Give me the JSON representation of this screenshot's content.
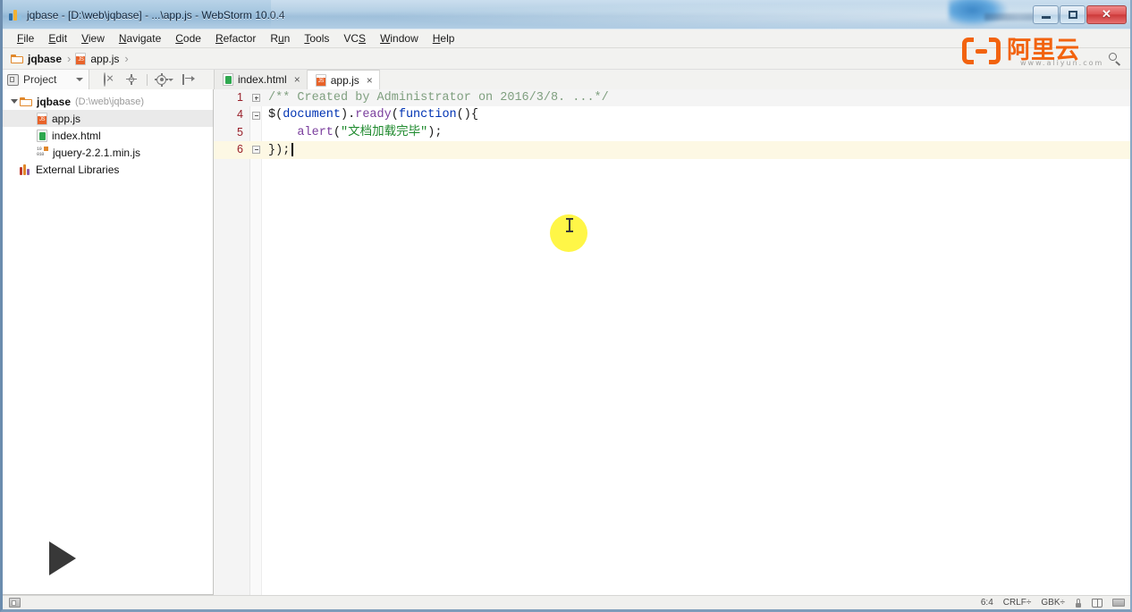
{
  "window": {
    "title": "jqbase - [D:\\web\\jqbase] - ...\\app.js - WebStorm 10.0.4",
    "icon": "webstorm-icon",
    "controls": {
      "minimize": "minimize-button",
      "maximize": "maximize-button",
      "close_label": "✕"
    }
  },
  "menu": {
    "items": [
      {
        "label": "File",
        "mnemonic": "F"
      },
      {
        "label": "Edit",
        "mnemonic": "E"
      },
      {
        "label": "View",
        "mnemonic": "V"
      },
      {
        "label": "Navigate",
        "mnemonic": "N"
      },
      {
        "label": "Code",
        "mnemonic": "C"
      },
      {
        "label": "Refactor",
        "mnemonic": "R"
      },
      {
        "label": "Run",
        "mnemonic": "u"
      },
      {
        "label": "Tools",
        "mnemonic": "T"
      },
      {
        "label": "VCS",
        "mnemonic": "S"
      },
      {
        "label": "Window",
        "mnemonic": "W"
      },
      {
        "label": "Help",
        "mnemonic": "H"
      }
    ]
  },
  "breadcrumb": {
    "separator": "›",
    "items": [
      {
        "label": "jqbase",
        "icon": "folder-icon",
        "bold": true
      },
      {
        "label": "app.js",
        "icon": "js-file-icon",
        "bold": false
      }
    ],
    "search_icon": "search-icon"
  },
  "tool_window": {
    "tab_label": "Project",
    "tab_icon": "project-icon",
    "dropdown_icon": "chevron-down-icon",
    "tools": [
      {
        "name": "collapse-all-icon",
        "title": "Collapse All"
      },
      {
        "name": "scroll-from-source-icon",
        "title": "Scroll from Source"
      },
      {
        "name": "settings-gear-icon",
        "title": "Settings"
      },
      {
        "name": "hide-panel-icon",
        "title": "Hide"
      }
    ]
  },
  "editor_tabs": [
    {
      "label": "index.html",
      "icon": "html-file-icon",
      "active": false,
      "close": "×"
    },
    {
      "label": "app.js",
      "icon": "js-file-icon",
      "active": true,
      "close": "×"
    }
  ],
  "project_tree": [
    {
      "label": "jqbase",
      "path_note": "(D:\\web\\jqbase)",
      "icon": "folder-icon",
      "expanded": true,
      "depth": 0,
      "selected": false,
      "bold": true
    },
    {
      "label": "app.js",
      "path_note": "",
      "icon": "js-file-icon",
      "expanded": false,
      "depth": 1,
      "selected": true,
      "bold": false
    },
    {
      "label": "index.html",
      "path_note": "",
      "icon": "html-file-icon",
      "expanded": false,
      "depth": 1,
      "selected": false,
      "bold": false
    },
    {
      "label": "jquery-2.2.1.min.js",
      "path_note": "",
      "icon": "minified-js-icon",
      "expanded": false,
      "depth": 1,
      "selected": false,
      "bold": false
    },
    {
      "label": "External Libraries",
      "path_note": "",
      "icon": "libraries-icon",
      "expanded": false,
      "depth": 0,
      "selected": false,
      "bold": false
    }
  ],
  "code": {
    "lines": [
      {
        "number": "1",
        "fold": "plus",
        "current": false,
        "shaded": true,
        "tokens": [
          {
            "text": "/** Created by Administrator on 2016/3/8. ...*/",
            "cls": "t-comment"
          }
        ]
      },
      {
        "number": "4",
        "fold": "minus",
        "current": false,
        "shaded": false,
        "tokens": [
          {
            "text": "$(",
            "cls": "t-punct"
          },
          {
            "text": "document",
            "cls": "t-kw"
          },
          {
            "text": ").",
            "cls": "t-punct"
          },
          {
            "text": "ready",
            "cls": "t-func"
          },
          {
            "text": "(",
            "cls": "t-punct"
          },
          {
            "text": "function",
            "cls": "t-kw"
          },
          {
            "text": "(){",
            "cls": "t-punct"
          }
        ]
      },
      {
        "number": "5",
        "fold": "none",
        "current": false,
        "shaded": false,
        "tokens": [
          {
            "text": "    ",
            "cls": "t-plain"
          },
          {
            "text": "alert",
            "cls": "t-func"
          },
          {
            "text": "(",
            "cls": "t-punct"
          },
          {
            "text": "\"文档加载完毕\"",
            "cls": "t-string"
          },
          {
            "text": ");",
            "cls": "t-punct"
          }
        ]
      },
      {
        "number": "6",
        "fold": "minus",
        "current": true,
        "shaded": false,
        "tokens": [
          {
            "text": "});",
            "cls": "t-punct"
          }
        ]
      }
    ],
    "inspection_status": "ok-check-icon",
    "caret_after": "});"
  },
  "overlays": {
    "play_button": "play-button-icon",
    "click_highlight": "click-highlight-bubble",
    "text_cursor": "ibeam-cursor-icon"
  },
  "watermark": {
    "text": "阿里云",
    "subtext": "www.aliyun.com",
    "color": "#f2630f"
  },
  "status_bar": {
    "left_icon": "memory-indicator-icon",
    "caret_position": "6:4",
    "line_separator": "CRLF÷",
    "encoding": "GBK÷",
    "lock_icon": "lock-icon",
    "reader_icon": "reader-mode-icon",
    "background_icon": "background-tasks-icon"
  }
}
